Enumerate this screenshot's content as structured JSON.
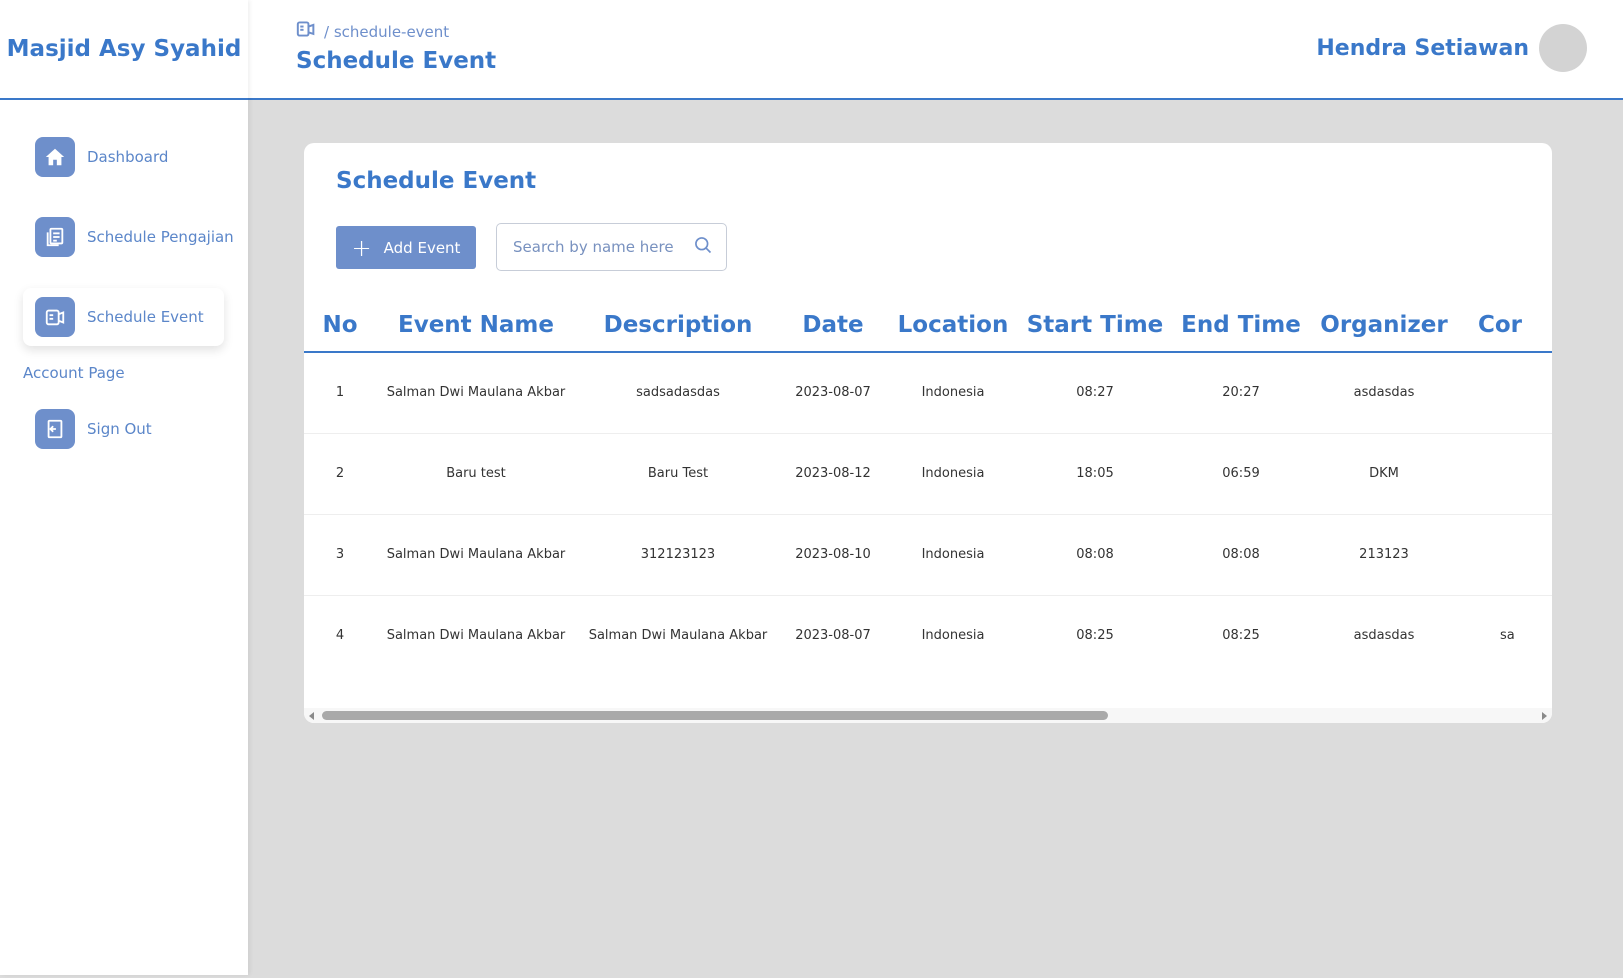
{
  "sidebar": {
    "brand": "Masjid Asy Syahid",
    "items": [
      {
        "label": "Dashboard",
        "icon": "home-icon"
      },
      {
        "label": "Schedule Pengajian",
        "icon": "document-list-icon"
      },
      {
        "label": "Schedule Event",
        "icon": "event-icon",
        "active": true
      }
    ],
    "section_label": "Account Page",
    "account_items": [
      {
        "label": "Sign Out",
        "icon": "sign-out-icon"
      }
    ]
  },
  "header": {
    "breadcrumb": "/ schedule-event",
    "title": "Schedule Event",
    "user_name": "Hendra Setiawan"
  },
  "main": {
    "card_title": "Schedule Event",
    "add_button_label": "Add Event",
    "search_placeholder": "Search by name here",
    "table": {
      "columns": [
        "No",
        "Event Name",
        "Description",
        "Date",
        "Location",
        "Start Time",
        "End Time",
        "Organizer",
        "Cor"
      ],
      "rows": [
        [
          "1",
          "Salman Dwi Maulana Akbar",
          "sadsadasdas",
          "2023-08-07",
          "Indonesia",
          "08:27",
          "20:27",
          "asdasdas",
          ""
        ],
        [
          "2",
          "Baru test",
          "Baru Test",
          "2023-08-12",
          "Indonesia",
          "18:05",
          "06:59",
          "DKM",
          ""
        ],
        [
          "3",
          "Salman Dwi Maulana Akbar",
          "312123123",
          "2023-08-10",
          "Indonesia",
          "08:08",
          "08:08",
          "213123",
          ""
        ],
        [
          "4",
          "Salman Dwi Maulana Akbar",
          "Salman Dwi Maulana Akbar",
          "2023-08-07",
          "Indonesia",
          "08:25",
          "08:25",
          "asdasdas",
          "sa"
        ]
      ]
    }
  },
  "colors": {
    "primary": "#3a78c9",
    "accent": "#6e8fcb",
    "background": "#dcdcdc"
  }
}
